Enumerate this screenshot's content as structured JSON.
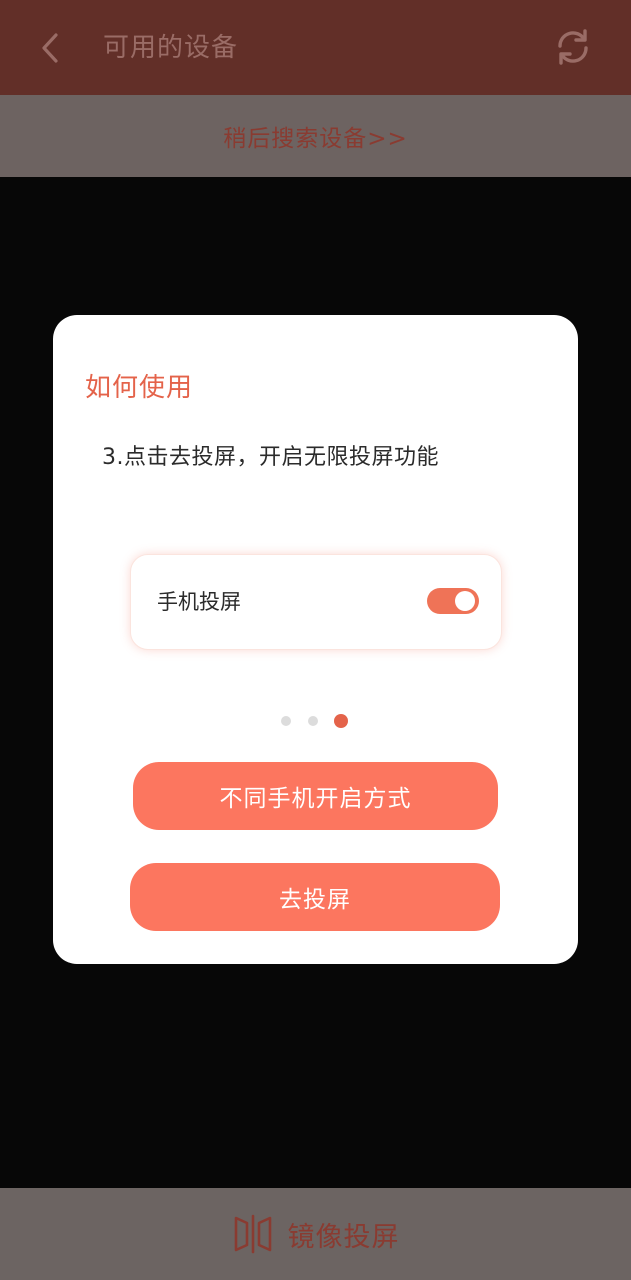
{
  "header": {
    "title": "可用的设备",
    "back_icon": "chevron-left-icon",
    "refresh_icon": "refresh-icon"
  },
  "search_later": {
    "label": "稍后搜索设备>>"
  },
  "dialog": {
    "title": "如何使用",
    "step_text": "3.点击去投屏，开启无限投屏功能",
    "toggle_card": {
      "label": "手机投屏",
      "toggle_on": true
    },
    "pagination": {
      "total": 3,
      "active_index": 2
    },
    "methods_button_label": "不同手机开启方式",
    "cast_button_label": "去投屏"
  },
  "bottom_bar": {
    "label": "镜像投屏",
    "icon": "mirror-icon"
  },
  "colors": {
    "accent": "#fc765f",
    "title_accent": "#e4634a",
    "header_dimmed": "#622f28",
    "overlay": "#070707"
  }
}
